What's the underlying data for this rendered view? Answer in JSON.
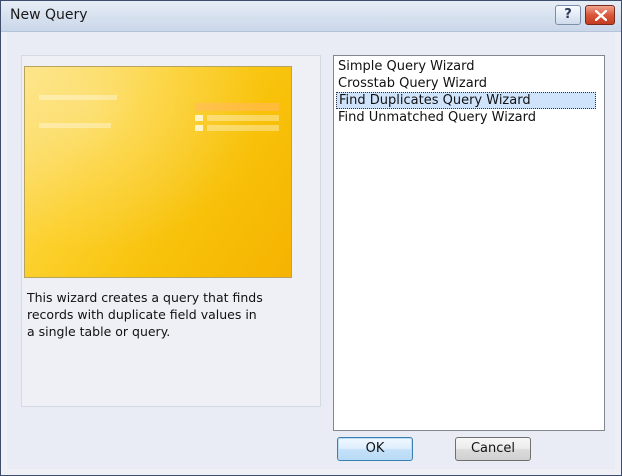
{
  "window": {
    "title": "New Query",
    "help_label": "?"
  },
  "preview": {
    "icon_name": "query-preview-illustration",
    "colors": {
      "background": "#fcd02c",
      "accent": "#f5b300"
    }
  },
  "description": "This wizard creates a query that finds records with duplicate field values in a single table or query.",
  "wizards": {
    "items": [
      {
        "label": "Simple Query Wizard"
      },
      {
        "label": "Crosstab Query Wizard"
      },
      {
        "label": "Find Duplicates Query Wizard"
      },
      {
        "label": "Find Unmatched Query Wizard"
      }
    ],
    "selected": "Find Duplicates Query Wizard"
  },
  "buttons": {
    "ok_label": "OK",
    "cancel_label": "Cancel"
  }
}
